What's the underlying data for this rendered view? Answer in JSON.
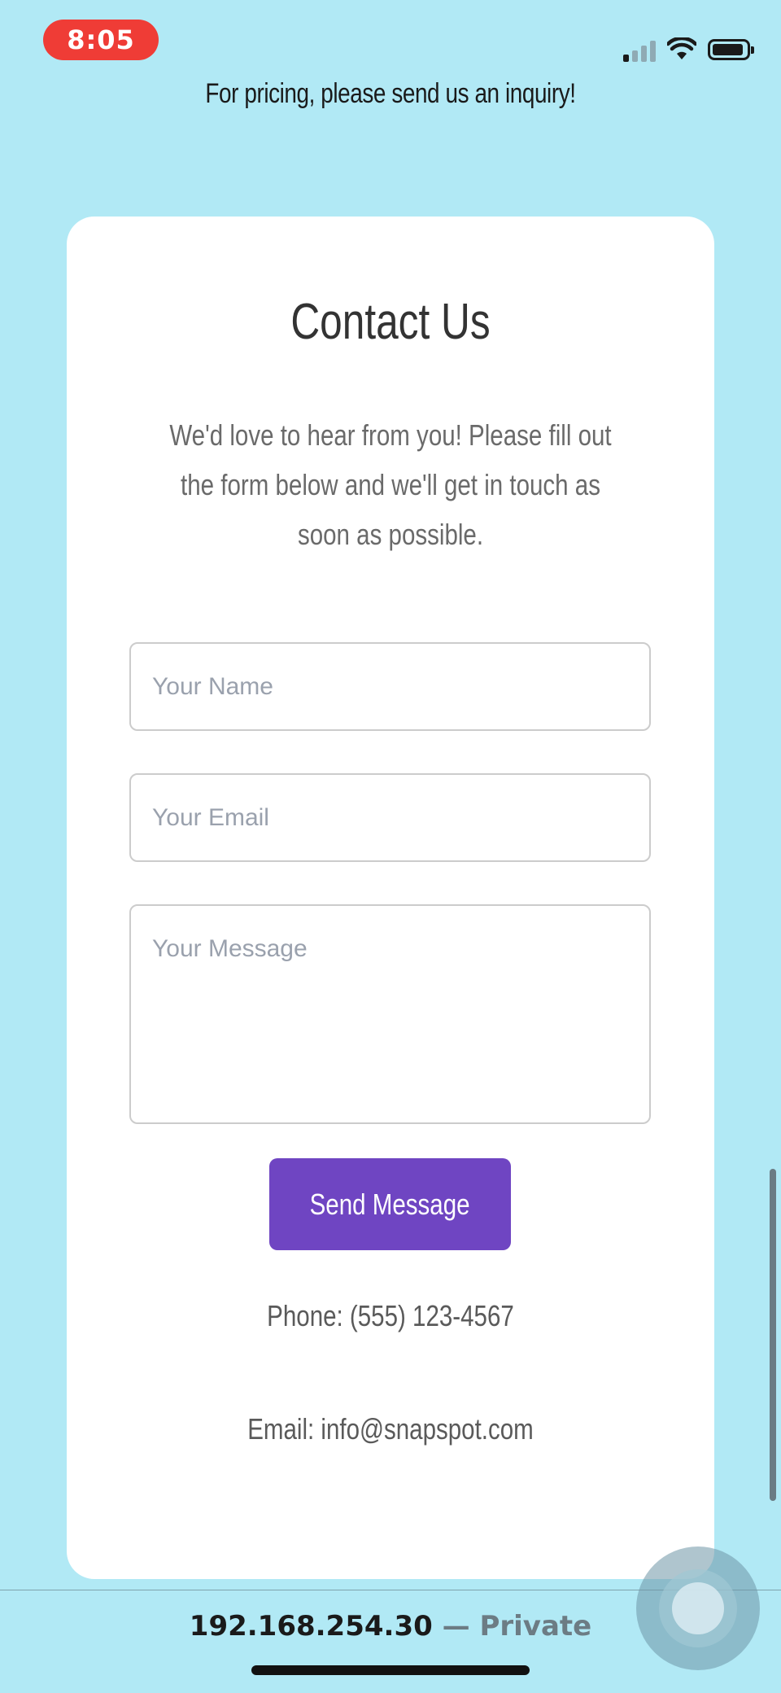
{
  "status_bar": {
    "time": "8:05",
    "icons": [
      "signal-icon",
      "wifi-icon",
      "battery-icon"
    ]
  },
  "page": {
    "pricing_note": "For pricing, please send us an inquiry!"
  },
  "contact_card": {
    "title": "Contact Us",
    "intro": "We'd love to hear from you! Please fill out the form below and we'll get in touch as soon as possible.",
    "name_placeholder": "Your Name",
    "email_placeholder": "Your Email",
    "message_placeholder": "Your Message",
    "send_label": "Send Message",
    "phone": "Phone: (555) 123-4567",
    "email": "Email: info@snapspot.com"
  },
  "browser": {
    "host": "192.168.254.30",
    "separator": "—",
    "mode": "Private"
  },
  "colors": {
    "background": "#b1e9f5",
    "card": "#ffffff",
    "button": "#6f45c2",
    "time_pill": "#ef3c36"
  }
}
